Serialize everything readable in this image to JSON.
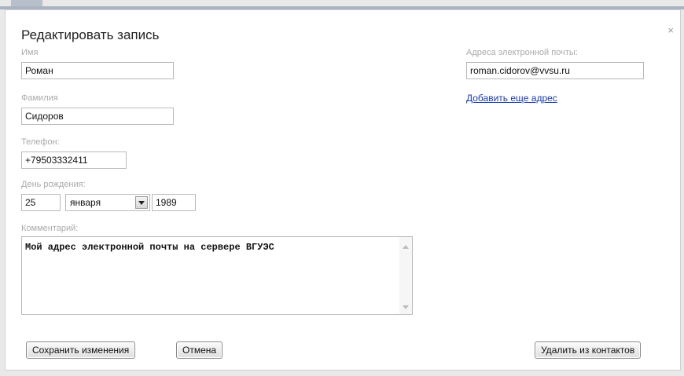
{
  "dialog": {
    "title": "Редактировать запись",
    "close_icon": "×"
  },
  "form": {
    "first_name": {
      "label": "Имя",
      "value": "Роман"
    },
    "last_name": {
      "label": "Фамилия",
      "value": "Сидоров"
    },
    "phone": {
      "label": "Телефон:",
      "value": "+79503332411"
    },
    "birthday": {
      "label": "День рождения:",
      "day": "25",
      "month": "января",
      "year": "1989"
    },
    "comment": {
      "label": "Комментарий:",
      "value": "Мой адрес электронной почты на сервере ВГУЭС"
    },
    "email": {
      "label": "Адреса электронной почты:",
      "value": "roman.cidorov@vvsu.ru",
      "add_link": "Добавить еще адрес"
    }
  },
  "buttons": {
    "save": "Сохранить изменения",
    "cancel": "Отмена",
    "delete": "Удалить из контактов"
  },
  "icons": {
    "close": "close-icon",
    "dropdown": "chevron-down-icon",
    "scroll_up": "scroll-up-icon",
    "scroll_down": "scroll-down-icon"
  }
}
